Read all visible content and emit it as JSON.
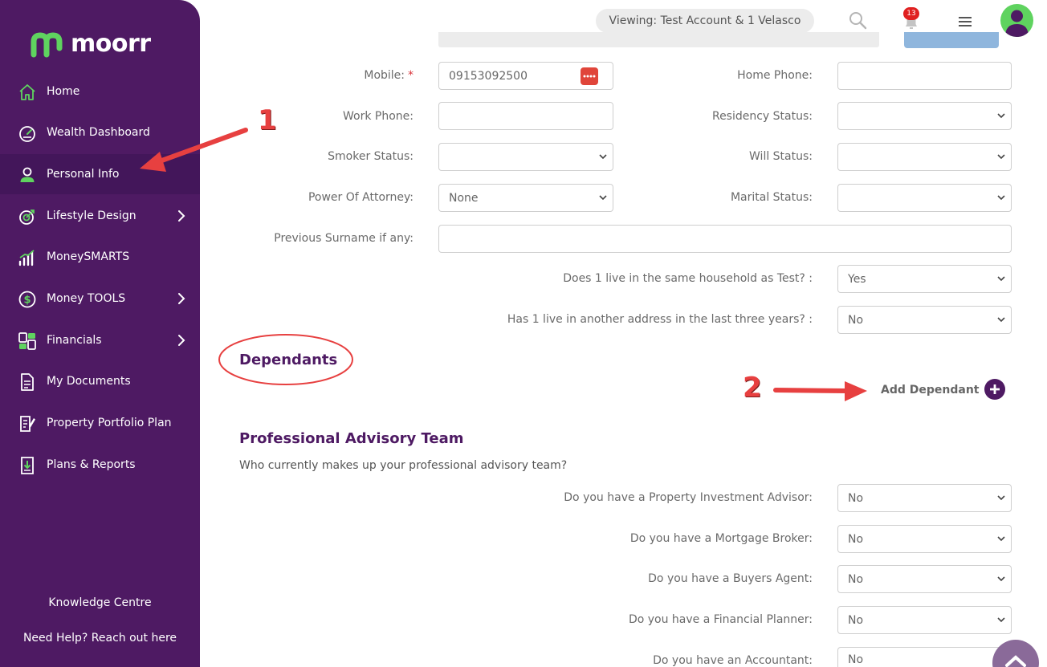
{
  "brand": {
    "name": "moorr",
    "logo_color": "#5fd35f"
  },
  "colors": {
    "sidebar": "#4e1a63",
    "accent_green": "#5fd35f",
    "annotation_red": "#e74040",
    "heading_purple": "#4e1a63"
  },
  "sidebar": {
    "items": [
      {
        "label": "Home",
        "icon": "home-icon"
      },
      {
        "label": "Wealth Dashboard",
        "icon": "gauge-icon"
      },
      {
        "label": "Personal Info",
        "icon": "user-icon",
        "active": true
      },
      {
        "label": "Lifestyle Design",
        "icon": "target-icon",
        "expandable": true
      },
      {
        "label": "MoneySMARTS",
        "icon": "bar-chart-icon"
      },
      {
        "label": "Money TOOLS",
        "icon": "dollar-coin-icon",
        "expandable": true
      },
      {
        "label": "Financials",
        "icon": "grid-icon",
        "expandable": true
      },
      {
        "label": "My Documents",
        "icon": "document-icon"
      },
      {
        "label": "Property Portfolio Plan",
        "icon": "edit-document-icon"
      },
      {
        "label": "Plans & Reports",
        "icon": "download-document-icon"
      }
    ],
    "knowledge_centre": "Knowledge Centre",
    "help": "Need Help? Reach out here"
  },
  "topbar": {
    "viewing": "Viewing: Test Account & 1 Velasco",
    "notification_count": "13"
  },
  "form": {
    "mobile": {
      "label": "Mobile:",
      "required_mark": "*",
      "value": "09153092500"
    },
    "home_phone": {
      "label": "Home Phone:",
      "value": ""
    },
    "work_phone": {
      "label": "Work Phone:",
      "value": ""
    },
    "residency_status": {
      "label": "Residency Status:",
      "value": ""
    },
    "smoker_status": {
      "label": "Smoker Status:",
      "value": ""
    },
    "will_status": {
      "label": "Will Status:",
      "value": ""
    },
    "power_of_attorney": {
      "label": "Power Of Attorney:",
      "value": "None"
    },
    "marital_status": {
      "label": "Marital Status:",
      "value": ""
    },
    "previous_surname": {
      "label": "Previous Surname if any:",
      "value": ""
    },
    "same_household": {
      "label": "Does 1 live in the same household as Test? :",
      "value": "Yes"
    },
    "other_address": {
      "label": "Has 1 live in another address in the last three years? :",
      "value": "No"
    }
  },
  "dependants": {
    "title": "Dependants",
    "add_label": "Add Dependant"
  },
  "advisory": {
    "title": "Professional Advisory Team",
    "subtitle": "Who currently makes up your professional advisory team?",
    "questions": [
      {
        "label": "Do you have a Property Investment Advisor:",
        "value": "No"
      },
      {
        "label": "Do you have a Mortgage Broker:",
        "value": "No"
      },
      {
        "label": "Do you have a Buyers Agent:",
        "value": "No"
      },
      {
        "label": "Do you have a Financial Planner:",
        "value": "No"
      },
      {
        "label": "Do you have an Accountant:",
        "value": "No"
      }
    ]
  },
  "annotations": {
    "step1": "1",
    "step2": "2"
  }
}
